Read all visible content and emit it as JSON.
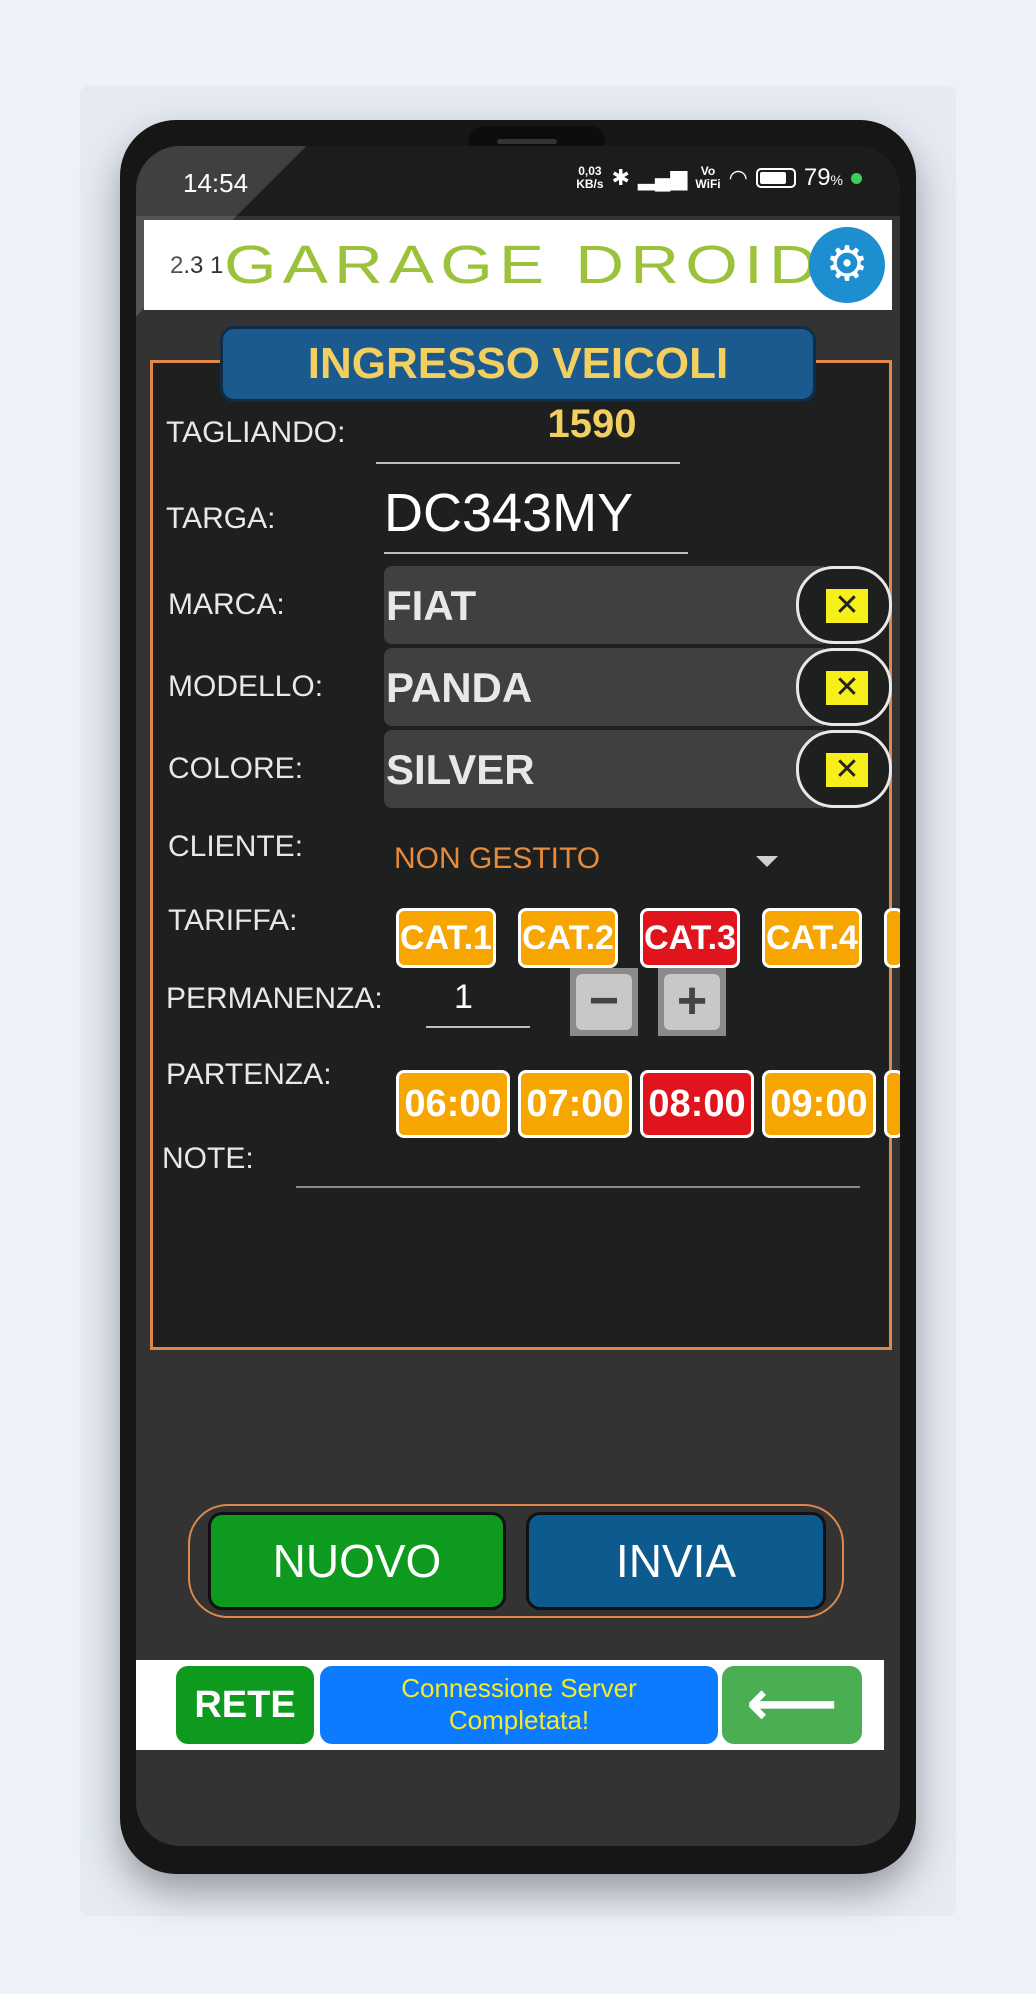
{
  "status_bar": {
    "time": "14:54",
    "net_speed": "0,03\nKB/s",
    "vowifi": "Vo\nWiFi",
    "battery": "79",
    "battery_unit": "%"
  },
  "header": {
    "version": "2.3 1",
    "logo_text": "GARAGE DROID",
    "settings_icon": "gear-icon"
  },
  "form": {
    "title": "INGRESSO VEICOLI",
    "tagliando_label": "TAGLIANDO:",
    "tagliando_value": "1590",
    "targa_label": "TARGA:",
    "targa_value": "DC343MY",
    "marca_label": "MARCA:",
    "marca_value": "FIAT",
    "modello_label": "MODELLO:",
    "modello_value": "PANDA",
    "colore_label": "COLORE:",
    "colore_value": "SILVER",
    "clear_glyph": "✕",
    "cliente_label": "CLIENTE:",
    "cliente_value": "NON GESTITO",
    "tariffa_label": "TARIFFA:",
    "tariffe": [
      "CAT.1",
      "CAT.2",
      "CAT.3",
      "CAT.4"
    ],
    "selected_tariffa": "CAT.3",
    "permanenza_label": "PERMANENZA:",
    "permanenza_value": "1",
    "minus_glyph": "−",
    "plus_glyph": "+",
    "partenza_label": "PARTENZA:",
    "partenze": [
      "06:00",
      "07:00",
      "08:00",
      "09:00"
    ],
    "selected_partenza": "08:00",
    "note_label": "NOTE:",
    "note_value": ""
  },
  "actions": {
    "nuovo": "NUOVO",
    "invia": "INVIA"
  },
  "footer": {
    "rete": "RETE",
    "status_line1": "Connessione Server",
    "status_line2": "Completata!",
    "back_glyph": "⟵"
  },
  "colors": {
    "accent_orange": "#f7a500",
    "selected_red": "#e0141c",
    "title_blue": "#1a5a8e",
    "nuovo_green": "#0d9a1e",
    "invia_blue": "#0d5a8e",
    "panel_border": "#e0884a"
  }
}
